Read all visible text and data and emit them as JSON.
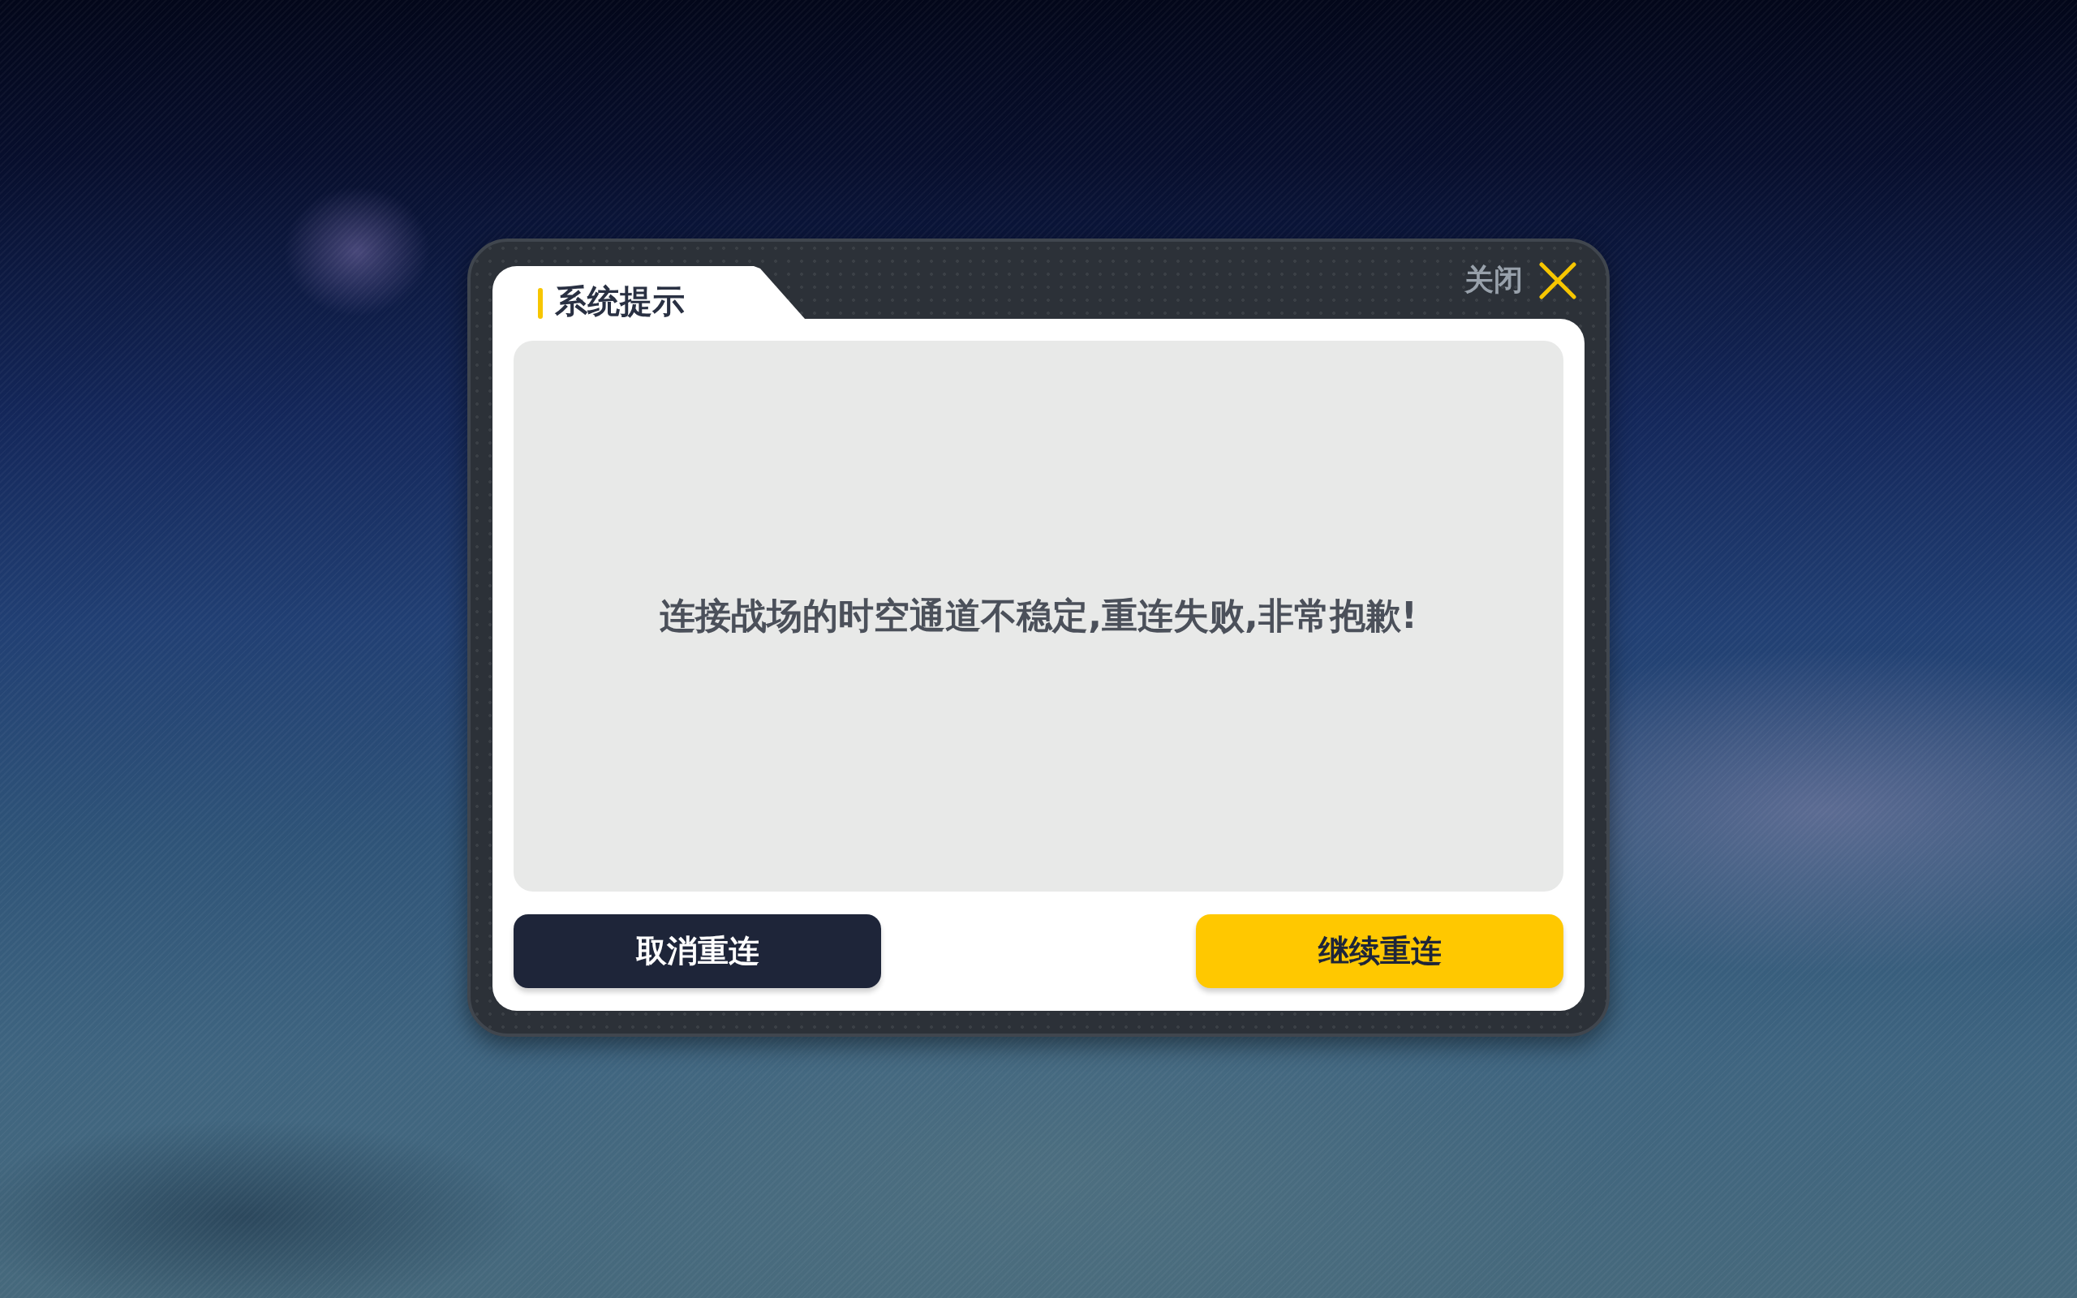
{
  "dialog": {
    "title": "系统提示",
    "close_label": "关闭",
    "message": "连接战场的时空通道不稳定,重连失败,非常抱歉!",
    "buttons": [
      {
        "label": "取消重连",
        "kind": "cancel"
      },
      {
        "label": "继续重连",
        "kind": "confirm"
      }
    ]
  }
}
